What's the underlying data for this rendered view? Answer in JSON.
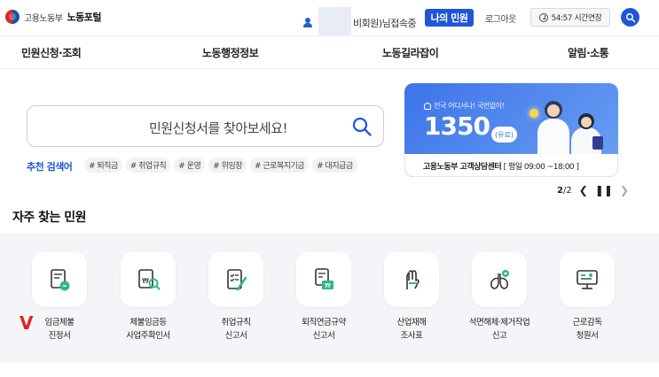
{
  "header": {
    "logo_small": "고용노동부",
    "logo_main": "노동포털",
    "user_status": "비회원)님접속중",
    "my_button": "나의 민원",
    "logout": "로그아웃",
    "session_extend": "54:57 시간연장"
  },
  "nav": {
    "items": [
      "민원신청·조회",
      "노동행정정보",
      "노동길라잡이",
      "알림·소통"
    ]
  },
  "search": {
    "placeholder": "민원신청서를 찾아보세요!",
    "recommend_label": "추천 검색어",
    "tags": [
      "# 퇴직금",
      "# 취업규칙",
      "# 운영",
      "# 위임장",
      "# 근로복지기금",
      "# 대지급금"
    ]
  },
  "banner": {
    "subtitle": "전국 어디서나! 국번없이!",
    "number": "1350",
    "paid": "(유료)",
    "caption_bold": "고용노동부 고객상담센터",
    "caption_hours": "[ 평일 09:00 ~18:00 ]"
  },
  "pager": {
    "current": "2",
    "total": "/2"
  },
  "frequent": {
    "title": "자주 찾는 민원",
    "items": [
      {
        "label": "임금체불\n진정서",
        "icon": "wage-arrears-icon"
      },
      {
        "label": "체불임금등\n사업주확인서",
        "icon": "employer-confirmation-icon"
      },
      {
        "label": "취업규칙\n신고서",
        "icon": "employment-rules-icon"
      },
      {
        "label": "퇴직연금규약\n신고서",
        "icon": "retirement-pension-icon"
      },
      {
        "label": "산업재해\n조사표",
        "icon": "industrial-accident-icon"
      },
      {
        "label": "석면해체·제거작업\n신고",
        "icon": "asbestos-icon"
      },
      {
        "label": "근로감독\n청원서",
        "icon": "labor-inspection-icon"
      }
    ]
  },
  "colors": {
    "primary": "#1f55d8",
    "banner": "#3d74e8",
    "section_bg": "#f3f5f8",
    "accent_green": "#2fb88a",
    "check": "#e0231f"
  }
}
